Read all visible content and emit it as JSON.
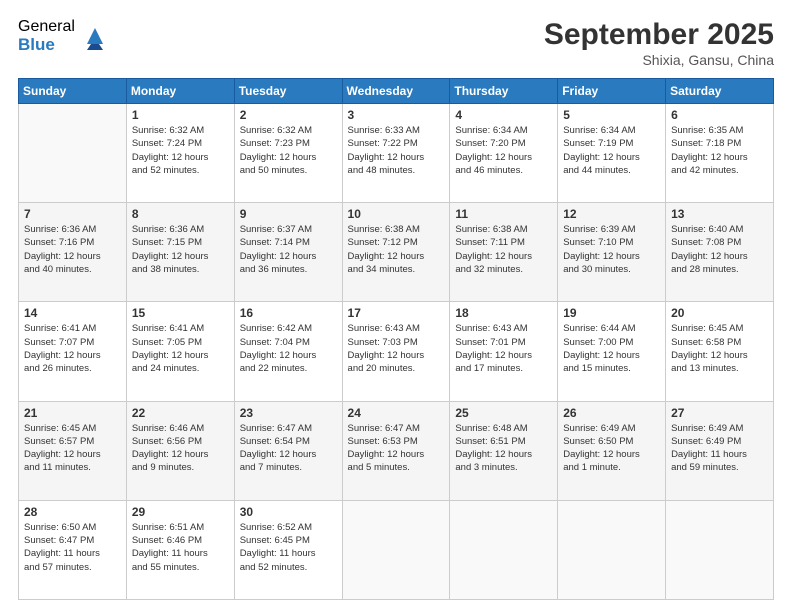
{
  "logo": {
    "general": "General",
    "blue": "Blue"
  },
  "title": "September 2025",
  "location": "Shixia, Gansu, China",
  "days_header": [
    "Sunday",
    "Monday",
    "Tuesday",
    "Wednesday",
    "Thursday",
    "Friday",
    "Saturday"
  ],
  "weeks": [
    [
      {
        "day": "",
        "info": ""
      },
      {
        "day": "1",
        "info": "Sunrise: 6:32 AM\nSunset: 7:24 PM\nDaylight: 12 hours\nand 52 minutes."
      },
      {
        "day": "2",
        "info": "Sunrise: 6:32 AM\nSunset: 7:23 PM\nDaylight: 12 hours\nand 50 minutes."
      },
      {
        "day": "3",
        "info": "Sunrise: 6:33 AM\nSunset: 7:22 PM\nDaylight: 12 hours\nand 48 minutes."
      },
      {
        "day": "4",
        "info": "Sunrise: 6:34 AM\nSunset: 7:20 PM\nDaylight: 12 hours\nand 46 minutes."
      },
      {
        "day": "5",
        "info": "Sunrise: 6:34 AM\nSunset: 7:19 PM\nDaylight: 12 hours\nand 44 minutes."
      },
      {
        "day": "6",
        "info": "Sunrise: 6:35 AM\nSunset: 7:18 PM\nDaylight: 12 hours\nand 42 minutes."
      }
    ],
    [
      {
        "day": "7",
        "info": "Sunrise: 6:36 AM\nSunset: 7:16 PM\nDaylight: 12 hours\nand 40 minutes."
      },
      {
        "day": "8",
        "info": "Sunrise: 6:36 AM\nSunset: 7:15 PM\nDaylight: 12 hours\nand 38 minutes."
      },
      {
        "day": "9",
        "info": "Sunrise: 6:37 AM\nSunset: 7:14 PM\nDaylight: 12 hours\nand 36 minutes."
      },
      {
        "day": "10",
        "info": "Sunrise: 6:38 AM\nSunset: 7:12 PM\nDaylight: 12 hours\nand 34 minutes."
      },
      {
        "day": "11",
        "info": "Sunrise: 6:38 AM\nSunset: 7:11 PM\nDaylight: 12 hours\nand 32 minutes."
      },
      {
        "day": "12",
        "info": "Sunrise: 6:39 AM\nSunset: 7:10 PM\nDaylight: 12 hours\nand 30 minutes."
      },
      {
        "day": "13",
        "info": "Sunrise: 6:40 AM\nSunset: 7:08 PM\nDaylight: 12 hours\nand 28 minutes."
      }
    ],
    [
      {
        "day": "14",
        "info": "Sunrise: 6:41 AM\nSunset: 7:07 PM\nDaylight: 12 hours\nand 26 minutes."
      },
      {
        "day": "15",
        "info": "Sunrise: 6:41 AM\nSunset: 7:05 PM\nDaylight: 12 hours\nand 24 minutes."
      },
      {
        "day": "16",
        "info": "Sunrise: 6:42 AM\nSunset: 7:04 PM\nDaylight: 12 hours\nand 22 minutes."
      },
      {
        "day": "17",
        "info": "Sunrise: 6:43 AM\nSunset: 7:03 PM\nDaylight: 12 hours\nand 20 minutes."
      },
      {
        "day": "18",
        "info": "Sunrise: 6:43 AM\nSunset: 7:01 PM\nDaylight: 12 hours\nand 17 minutes."
      },
      {
        "day": "19",
        "info": "Sunrise: 6:44 AM\nSunset: 7:00 PM\nDaylight: 12 hours\nand 15 minutes."
      },
      {
        "day": "20",
        "info": "Sunrise: 6:45 AM\nSunset: 6:58 PM\nDaylight: 12 hours\nand 13 minutes."
      }
    ],
    [
      {
        "day": "21",
        "info": "Sunrise: 6:45 AM\nSunset: 6:57 PM\nDaylight: 12 hours\nand 11 minutes."
      },
      {
        "day": "22",
        "info": "Sunrise: 6:46 AM\nSunset: 6:56 PM\nDaylight: 12 hours\nand 9 minutes."
      },
      {
        "day": "23",
        "info": "Sunrise: 6:47 AM\nSunset: 6:54 PM\nDaylight: 12 hours\nand 7 minutes."
      },
      {
        "day": "24",
        "info": "Sunrise: 6:47 AM\nSunset: 6:53 PM\nDaylight: 12 hours\nand 5 minutes."
      },
      {
        "day": "25",
        "info": "Sunrise: 6:48 AM\nSunset: 6:51 PM\nDaylight: 12 hours\nand 3 minutes."
      },
      {
        "day": "26",
        "info": "Sunrise: 6:49 AM\nSunset: 6:50 PM\nDaylight: 12 hours\nand 1 minute."
      },
      {
        "day": "27",
        "info": "Sunrise: 6:49 AM\nSunset: 6:49 PM\nDaylight: 11 hours\nand 59 minutes."
      }
    ],
    [
      {
        "day": "28",
        "info": "Sunrise: 6:50 AM\nSunset: 6:47 PM\nDaylight: 11 hours\nand 57 minutes."
      },
      {
        "day": "29",
        "info": "Sunrise: 6:51 AM\nSunset: 6:46 PM\nDaylight: 11 hours\nand 55 minutes."
      },
      {
        "day": "30",
        "info": "Sunrise: 6:52 AM\nSunset: 6:45 PM\nDaylight: 11 hours\nand 52 minutes."
      },
      {
        "day": "",
        "info": ""
      },
      {
        "day": "",
        "info": ""
      },
      {
        "day": "",
        "info": ""
      },
      {
        "day": "",
        "info": ""
      }
    ]
  ]
}
